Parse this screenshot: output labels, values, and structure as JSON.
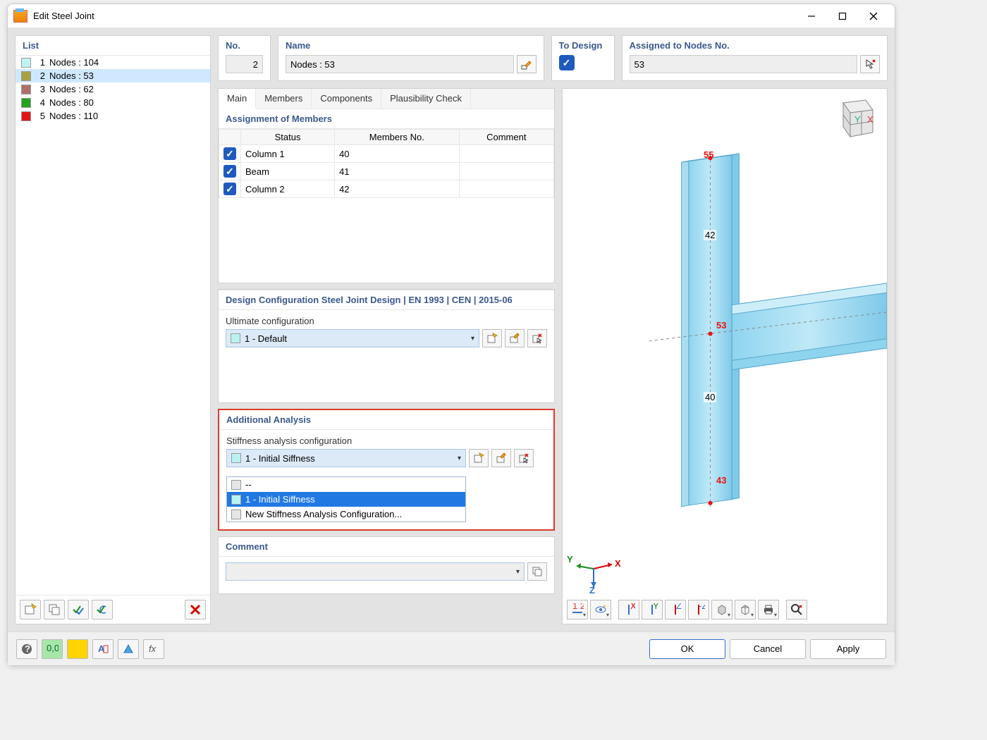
{
  "window": {
    "title": "Edit Steel Joint"
  },
  "list": {
    "header": "List",
    "items": [
      {
        "idx": "1",
        "label": "Nodes : 104",
        "color": "#bff3f1",
        "selected": false
      },
      {
        "idx": "2",
        "label": "Nodes : 53",
        "color": "#a7a143",
        "selected": true
      },
      {
        "idx": "3",
        "label": "Nodes : 62",
        "color": "#b06f6a",
        "selected": false
      },
      {
        "idx": "4",
        "label": "Nodes : 80",
        "color": "#27a21f",
        "selected": false
      },
      {
        "idx": "5",
        "label": "Nodes : 110",
        "color": "#e11717",
        "selected": false
      }
    ]
  },
  "top": {
    "no_label": "No.",
    "no_value": "2",
    "name_label": "Name",
    "name_value": "Nodes : 53",
    "todesign_label": "To Design",
    "assigned_label": "Assigned to Nodes No.",
    "assigned_value": "53"
  },
  "tabs": {
    "items": [
      "Main",
      "Members",
      "Components",
      "Plausibility Check"
    ],
    "active": 0
  },
  "assignment": {
    "header": "Assignment of Members",
    "cols": {
      "status": "Status",
      "members": "Members No.",
      "comment": "Comment"
    },
    "rows": [
      {
        "status": "Column 1",
        "members": "40",
        "comment": ""
      },
      {
        "status": "Beam",
        "members": "41",
        "comment": ""
      },
      {
        "status": "Column 2",
        "members": "42",
        "comment": ""
      }
    ]
  },
  "design": {
    "header": "Design Configuration Steel Joint Design | EN 1993 | CEN | 2015-06",
    "label": "Ultimate configuration",
    "value": "1 - Default"
  },
  "analysis": {
    "header": "Additional Analysis",
    "label": "Stiffness analysis configuration",
    "value": "1 - Initial Siffness",
    "options": [
      "--",
      "1 - Initial Siffness",
      "New Stiffness Analysis Configuration..."
    ],
    "selected_index": 1
  },
  "comment": {
    "header": "Comment",
    "value": ""
  },
  "viewport": {
    "nodes": {
      "top": "55",
      "mid": "53",
      "bot": "43"
    },
    "members": {
      "upper": "42",
      "lower": "40"
    }
  },
  "axes": {
    "x": "X",
    "y": "Y",
    "z": "Z"
  },
  "buttons": {
    "ok": "OK",
    "cancel": "Cancel",
    "apply": "Apply"
  }
}
